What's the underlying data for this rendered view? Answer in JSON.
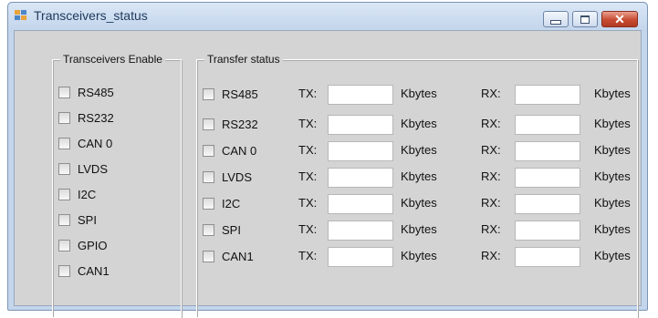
{
  "window": {
    "title": "Transceivers_status",
    "close_glyph": "✕"
  },
  "enable_group": {
    "title": "Transceivers Enable",
    "items": [
      {
        "label": "RS485",
        "checked": false
      },
      {
        "label": "RS232",
        "checked": false
      },
      {
        "label": "CAN 0",
        "checked": false
      },
      {
        "label": "LVDS",
        "checked": false
      },
      {
        "label": "I2C",
        "checked": false
      },
      {
        "label": "SPI",
        "checked": false
      },
      {
        "label": "GPIO",
        "checked": false
      },
      {
        "label": "CAN1",
        "checked": false
      }
    ]
  },
  "transfer_group": {
    "title": "Transfer status",
    "tx_label": "TX:",
    "rx_label": "RX:",
    "unit": "Kbytes",
    "rows": [
      {
        "label": "RS485",
        "tx": "",
        "rx": ""
      },
      {
        "label": "RS232",
        "tx": "",
        "rx": ""
      },
      {
        "label": "CAN 0",
        "tx": "",
        "rx": ""
      },
      {
        "label": "LVDS",
        "tx": "",
        "rx": ""
      },
      {
        "label": "I2C",
        "tx": "",
        "rx": ""
      },
      {
        "label": "SPI",
        "tx": "",
        "rx": ""
      },
      {
        "label": "CAN1",
        "tx": "",
        "rx": ""
      }
    ]
  },
  "colors": {
    "client_bg": "#d4d4d4",
    "window_frame": "#c4d6ec",
    "close_button": "#c74b32"
  }
}
